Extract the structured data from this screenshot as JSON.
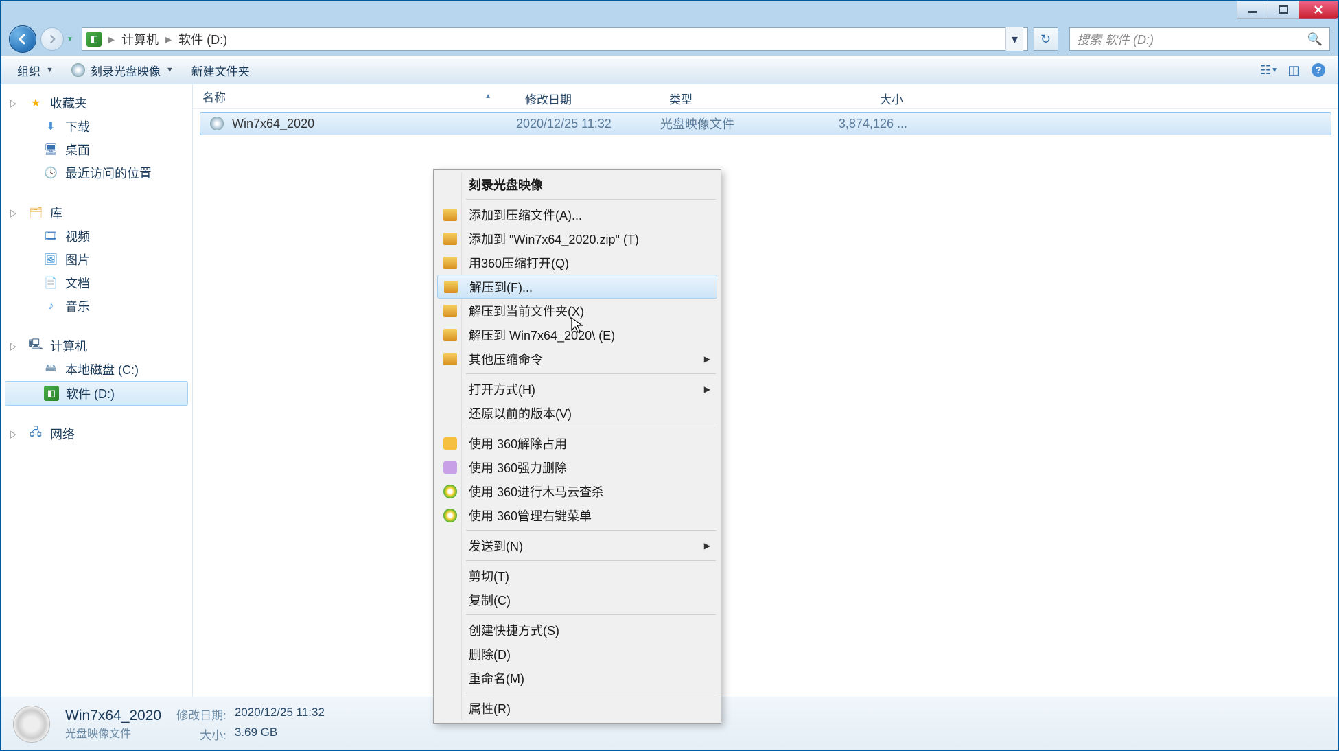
{
  "breadcrumb": {
    "root": "计算机",
    "current": "软件 (D:)"
  },
  "search": {
    "placeholder": "搜索 软件 (D:)"
  },
  "toolbar": {
    "organize": "组织",
    "burn": "刻录光盘映像",
    "newfolder": "新建文件夹"
  },
  "columns": {
    "name": "名称",
    "date": "修改日期",
    "type": "类型",
    "size": "大小"
  },
  "file": {
    "name": "Win7x64_2020",
    "date": "2020/12/25 11:32",
    "type": "光盘映像文件",
    "size": "3,874,126 ..."
  },
  "sidebar": {
    "fav": "收藏夹",
    "fav_items": {
      "downloads": "下载",
      "desktop": "桌面",
      "recent": "最近访问的位置"
    },
    "lib": "库",
    "lib_items": {
      "videos": "视频",
      "pictures": "图片",
      "documents": "文档",
      "music": "音乐"
    },
    "computer": "计算机",
    "drives": {
      "c": "本地磁盘 (C:)",
      "d": "软件 (D:)"
    },
    "network": "网络"
  },
  "ctx": {
    "burn": "刻录光盘映像",
    "add_archive": "添加到压缩文件(A)...",
    "add_zip": "添加到 \"Win7x64_2020.zip\" (T)",
    "open_360zip": "用360压缩打开(Q)",
    "extract_to": "解压到(F)...",
    "extract_here": "解压到当前文件夹(X)",
    "extract_folder": "解压到 Win7x64_2020\\ (E)",
    "other_zip": "其他压缩命令",
    "open_with": "打开方式(H)",
    "restore": "还原以前的版本(V)",
    "unlock_360": "使用 360解除占用",
    "force_del_360": "使用 360强力删除",
    "trojan_360": "使用 360进行木马云查杀",
    "manage_360": "使用 360管理右键菜单",
    "send_to": "发送到(N)",
    "cut": "剪切(T)",
    "copy": "复制(C)",
    "shortcut": "创建快捷方式(S)",
    "delete": "删除(D)",
    "rename": "重命名(M)",
    "properties": "属性(R)"
  },
  "details": {
    "name": "Win7x64_2020",
    "type": "光盘映像文件",
    "date_lbl": "修改日期:",
    "date_val": "2020/12/25 11:32",
    "size_lbl": "大小:",
    "size_val": "3.69 GB"
  }
}
